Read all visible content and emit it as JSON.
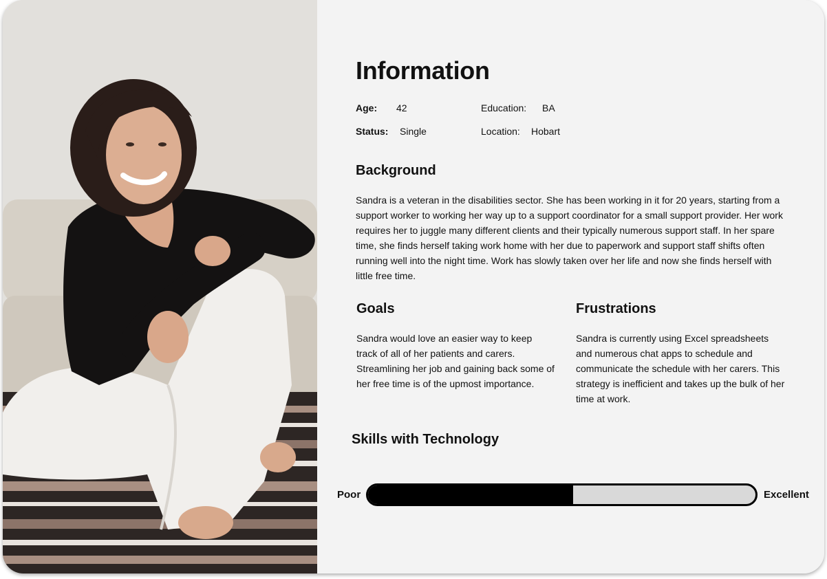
{
  "persona": {
    "title": "Information",
    "age": {
      "label": "Age:",
      "value": "42"
    },
    "education": {
      "label": "Education:",
      "value": "BA"
    },
    "status": {
      "label": "Status:",
      "value": "Single"
    },
    "location": {
      "label": "Location:",
      "value": "Hobart"
    }
  },
  "background": {
    "heading": "Background",
    "text": "Sandra is a veteran in the disabilities sector.  She has been working in it for 20 years, starting from a support worker to working her way up to a support coordinator for a small support provider. Her work requires her to juggle many different clients and their typically numerous support staff.  In her spare time, she finds herself taking work home with her due to paperwork and support staff shifts often running well into the night time.  Work has slowly taken over her life and now she finds herself with little free time."
  },
  "goals": {
    "heading": "Goals",
    "text": "Sandra would love an easier way to keep track of all of her patients and carers. Streamlining her job and gaining back  some of her free time is of the upmost importance."
  },
  "frustrations": {
    "heading": "Frustrations",
    "text": "Sandra is currently using Excel spreadsheets and numerous chat apps to schedule and communicate the schedule with her carers. This strategy is inefficient and takes up the bulk of her time at work."
  },
  "skills": {
    "heading": "Skills with Technology",
    "low_label": "Poor",
    "high_label": "Excellent",
    "level_fraction": 0.53
  },
  "photo": {
    "icon": "persona-photo"
  },
  "colors": {
    "background": "#f3f3f3",
    "text": "#111111",
    "bar_fill": "#000000",
    "bar_track": "#d9d9d9"
  }
}
